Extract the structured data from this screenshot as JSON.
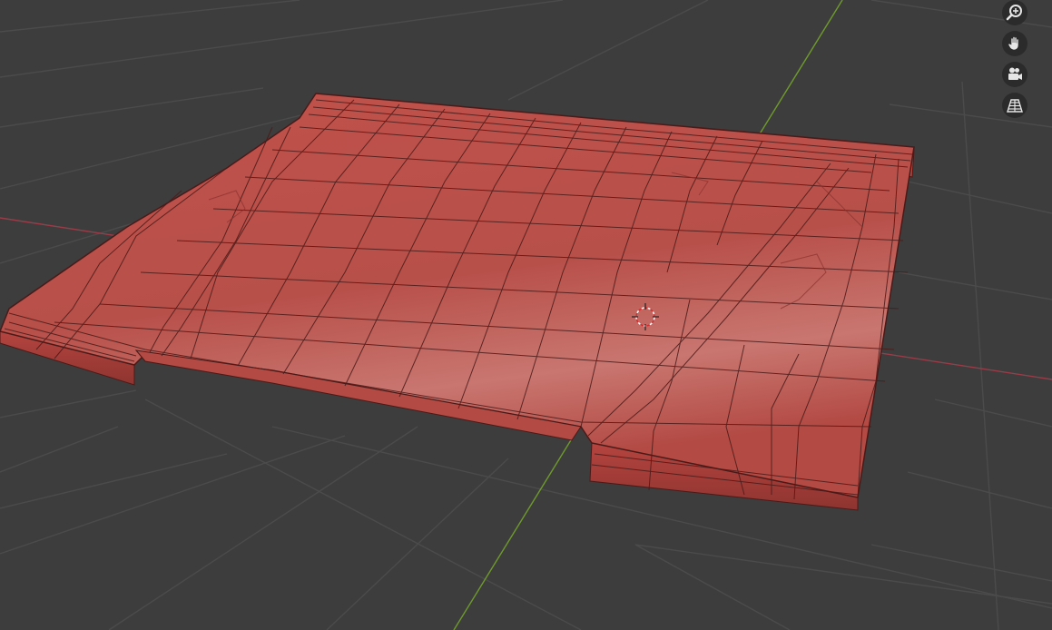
{
  "viewport": {
    "colors": {
      "background": "#3d3d3d",
      "grid_line": "#4a4a4a",
      "x_axis": "#9a3c48",
      "y_axis": "#6f9a2c",
      "mesh_fill": "#c55850",
      "mesh_edge": "#4a1a18"
    }
  },
  "navigation_gizmo": {
    "buttons": [
      {
        "icon": "zoom-icon"
      },
      {
        "icon": "pan-hand-icon"
      },
      {
        "icon": "camera-view-icon"
      },
      {
        "icon": "perspective-grid-icon"
      }
    ]
  }
}
